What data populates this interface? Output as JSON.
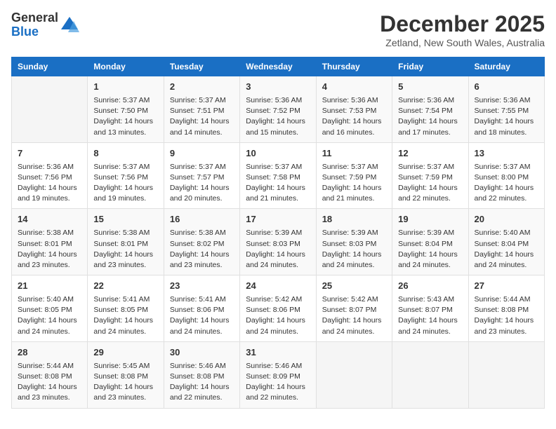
{
  "logo": {
    "general": "General",
    "blue": "Blue"
  },
  "header": {
    "month": "December 2025",
    "location": "Zetland, New South Wales, Australia"
  },
  "weekdays": [
    "Sunday",
    "Monday",
    "Tuesday",
    "Wednesday",
    "Thursday",
    "Friday",
    "Saturday"
  ],
  "weeks": [
    [
      {
        "day": "",
        "info": ""
      },
      {
        "day": "1",
        "info": "Sunrise: 5:37 AM\nSunset: 7:50 PM\nDaylight: 14 hours\nand 13 minutes."
      },
      {
        "day": "2",
        "info": "Sunrise: 5:37 AM\nSunset: 7:51 PM\nDaylight: 14 hours\nand 14 minutes."
      },
      {
        "day": "3",
        "info": "Sunrise: 5:36 AM\nSunset: 7:52 PM\nDaylight: 14 hours\nand 15 minutes."
      },
      {
        "day": "4",
        "info": "Sunrise: 5:36 AM\nSunset: 7:53 PM\nDaylight: 14 hours\nand 16 minutes."
      },
      {
        "day": "5",
        "info": "Sunrise: 5:36 AM\nSunset: 7:54 PM\nDaylight: 14 hours\nand 17 minutes."
      },
      {
        "day": "6",
        "info": "Sunrise: 5:36 AM\nSunset: 7:55 PM\nDaylight: 14 hours\nand 18 minutes."
      }
    ],
    [
      {
        "day": "7",
        "info": "Sunrise: 5:36 AM\nSunset: 7:56 PM\nDaylight: 14 hours\nand 19 minutes."
      },
      {
        "day": "8",
        "info": "Sunrise: 5:37 AM\nSunset: 7:56 PM\nDaylight: 14 hours\nand 19 minutes."
      },
      {
        "day": "9",
        "info": "Sunrise: 5:37 AM\nSunset: 7:57 PM\nDaylight: 14 hours\nand 20 minutes."
      },
      {
        "day": "10",
        "info": "Sunrise: 5:37 AM\nSunset: 7:58 PM\nDaylight: 14 hours\nand 21 minutes."
      },
      {
        "day": "11",
        "info": "Sunrise: 5:37 AM\nSunset: 7:59 PM\nDaylight: 14 hours\nand 21 minutes."
      },
      {
        "day": "12",
        "info": "Sunrise: 5:37 AM\nSunset: 7:59 PM\nDaylight: 14 hours\nand 22 minutes."
      },
      {
        "day": "13",
        "info": "Sunrise: 5:37 AM\nSunset: 8:00 PM\nDaylight: 14 hours\nand 22 minutes."
      }
    ],
    [
      {
        "day": "14",
        "info": "Sunrise: 5:38 AM\nSunset: 8:01 PM\nDaylight: 14 hours\nand 23 minutes."
      },
      {
        "day": "15",
        "info": "Sunrise: 5:38 AM\nSunset: 8:01 PM\nDaylight: 14 hours\nand 23 minutes."
      },
      {
        "day": "16",
        "info": "Sunrise: 5:38 AM\nSunset: 8:02 PM\nDaylight: 14 hours\nand 23 minutes."
      },
      {
        "day": "17",
        "info": "Sunrise: 5:39 AM\nSunset: 8:03 PM\nDaylight: 14 hours\nand 24 minutes."
      },
      {
        "day": "18",
        "info": "Sunrise: 5:39 AM\nSunset: 8:03 PM\nDaylight: 14 hours\nand 24 minutes."
      },
      {
        "day": "19",
        "info": "Sunrise: 5:39 AM\nSunset: 8:04 PM\nDaylight: 14 hours\nand 24 minutes."
      },
      {
        "day": "20",
        "info": "Sunrise: 5:40 AM\nSunset: 8:04 PM\nDaylight: 14 hours\nand 24 minutes."
      }
    ],
    [
      {
        "day": "21",
        "info": "Sunrise: 5:40 AM\nSunset: 8:05 PM\nDaylight: 14 hours\nand 24 minutes."
      },
      {
        "day": "22",
        "info": "Sunrise: 5:41 AM\nSunset: 8:05 PM\nDaylight: 14 hours\nand 24 minutes."
      },
      {
        "day": "23",
        "info": "Sunrise: 5:41 AM\nSunset: 8:06 PM\nDaylight: 14 hours\nand 24 minutes."
      },
      {
        "day": "24",
        "info": "Sunrise: 5:42 AM\nSunset: 8:06 PM\nDaylight: 14 hours\nand 24 minutes."
      },
      {
        "day": "25",
        "info": "Sunrise: 5:42 AM\nSunset: 8:07 PM\nDaylight: 14 hours\nand 24 minutes."
      },
      {
        "day": "26",
        "info": "Sunrise: 5:43 AM\nSunset: 8:07 PM\nDaylight: 14 hours\nand 24 minutes."
      },
      {
        "day": "27",
        "info": "Sunrise: 5:44 AM\nSunset: 8:08 PM\nDaylight: 14 hours\nand 23 minutes."
      }
    ],
    [
      {
        "day": "28",
        "info": "Sunrise: 5:44 AM\nSunset: 8:08 PM\nDaylight: 14 hours\nand 23 minutes."
      },
      {
        "day": "29",
        "info": "Sunrise: 5:45 AM\nSunset: 8:08 PM\nDaylight: 14 hours\nand 23 minutes."
      },
      {
        "day": "30",
        "info": "Sunrise: 5:46 AM\nSunset: 8:08 PM\nDaylight: 14 hours\nand 22 minutes."
      },
      {
        "day": "31",
        "info": "Sunrise: 5:46 AM\nSunset: 8:09 PM\nDaylight: 14 hours\nand 22 minutes."
      },
      {
        "day": "",
        "info": ""
      },
      {
        "day": "",
        "info": ""
      },
      {
        "day": "",
        "info": ""
      }
    ]
  ]
}
